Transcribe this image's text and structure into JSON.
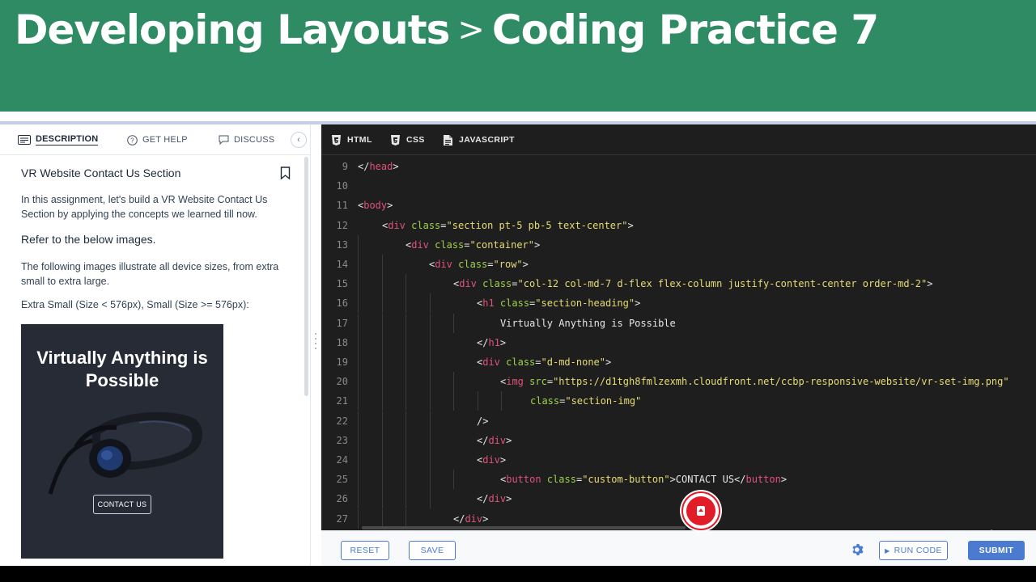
{
  "banner": {
    "part1": "Developing Layouts",
    "separator": ">",
    "part2": "Coding Practice 7"
  },
  "left_tabs": [
    {
      "label": "DESCRIPTION",
      "icon": "description-icon"
    },
    {
      "label": "GET HELP",
      "icon": "help-icon"
    },
    {
      "label": "DISCUSS",
      "icon": "discuss-icon"
    }
  ],
  "question": {
    "title": "VR Website Contact Us Section",
    "intro": "In this assignment, let's build a VR Website Contact Us Section by applying the concepts we learned till now.",
    "refer": "Refer to the below images.",
    "illustrate": "The following images illustrate all device sizes, from extra small to extra large.",
    "sizes": "Extra Small (Size < 576px), Small (Size >= 576px):"
  },
  "preview": {
    "heading": "Virtually Anything is Possible",
    "button": "CONTACT US"
  },
  "editor_tabs": [
    {
      "label": "HTML"
    },
    {
      "label": "CSS"
    },
    {
      "label": "JAVASCRIPT"
    }
  ],
  "code_lines": [
    {
      "n": "9",
      "text": "</head>"
    },
    {
      "n": "10",
      "text": ""
    },
    {
      "n": "11",
      "text": "<body>"
    },
    {
      "n": "12",
      "text": "<div class=\"section pt-5 pb-5 text-center\">"
    },
    {
      "n": "13",
      "text": "<div class=\"container\">"
    },
    {
      "n": "14",
      "text": "<div class=\"row\">"
    },
    {
      "n": "15",
      "text": "<div class=\"col-12 col-md-7 d-flex flex-column justify-content-center order-md-2\">"
    },
    {
      "n": "16",
      "text": "<h1 class=\"section-heading\">"
    },
    {
      "n": "17",
      "text": "Virtually Anything is Possible"
    },
    {
      "n": "18",
      "text": "</h1>"
    },
    {
      "n": "19",
      "text": "<div class=\"d-md-none\">"
    },
    {
      "n": "20",
      "text": "<img src=\"https://d1tgh8fmlzexmh.cloudfront.net/ccbp-responsive-website/vr-set-img.png\""
    },
    {
      "n": "21",
      "text": "class=\"section-img\""
    },
    {
      "n": "22",
      "text": "/>"
    },
    {
      "n": "23",
      "text": "</div>"
    },
    {
      "n": "24",
      "text": "<div>"
    },
    {
      "n": "25",
      "text": "<button class=\"custom-button\">CONTACT US</button>"
    },
    {
      "n": "26",
      "text": "</div>"
    },
    {
      "n": "27",
      "text": "</div>"
    }
  ],
  "bottom": {
    "reset": "RESET",
    "save": "SAVE",
    "run": "RUN CODE",
    "submit": "SUBMIT"
  },
  "colors": {
    "banner": "#2e8b63",
    "editor_bg": "#1e1e1e",
    "accent": "#4b7bd1",
    "tag": "#e0527a",
    "attr": "#9fd14a",
    "string": "#e6db74"
  }
}
